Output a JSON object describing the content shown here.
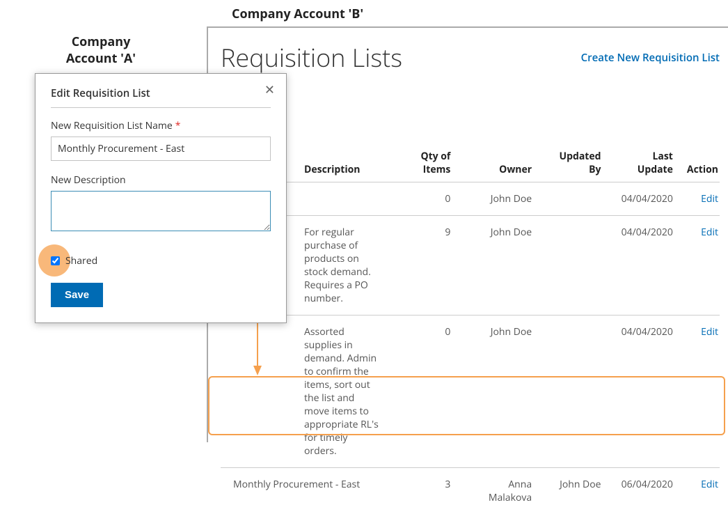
{
  "annotations": {
    "company_a": "Company Account 'A'",
    "company_b": "Company Account 'B'"
  },
  "header": {
    "title": "Requisition Lists",
    "create_link": "Create New Requisition List"
  },
  "table": {
    "headers": {
      "description": "Description",
      "qty": "Qty of Items",
      "owner": "Owner",
      "updated_by": "Updated By",
      "last_update": "Last Update",
      "action": "Action"
    },
    "rows": [
      {
        "description": "",
        "qty": "0",
        "owner": "John Doe",
        "updated_by": "",
        "last_update": "04/04/2020",
        "action": "Edit"
      },
      {
        "description": "For regular purchase of products on stock demand. Requires a PO number.",
        "qty": "9",
        "owner": "John Doe",
        "updated_by": "",
        "last_update": "04/04/2020",
        "action": "Edit"
      },
      {
        "description": "Assorted supplies in demand. Admin to confirm the items, sort out the list and move items to appropriate RL's for timely orders.",
        "qty": "0",
        "owner": "John Doe",
        "updated_by": "",
        "last_update": "04/04/2020",
        "action": "Edit"
      },
      {
        "description": "Monthly Procurement - East",
        "qty": "3",
        "owner": "Anna Malakova",
        "updated_by": "John Doe",
        "last_update": "06/04/2020",
        "action": "Edit"
      }
    ]
  },
  "dialog": {
    "title": "Edit Requisition List",
    "name_label": "New Requisition List Name",
    "name_value": "Monthly Procurement - East",
    "desc_label": "New Description",
    "desc_value": "",
    "shared_label": "Shared",
    "save_label": "Save"
  }
}
